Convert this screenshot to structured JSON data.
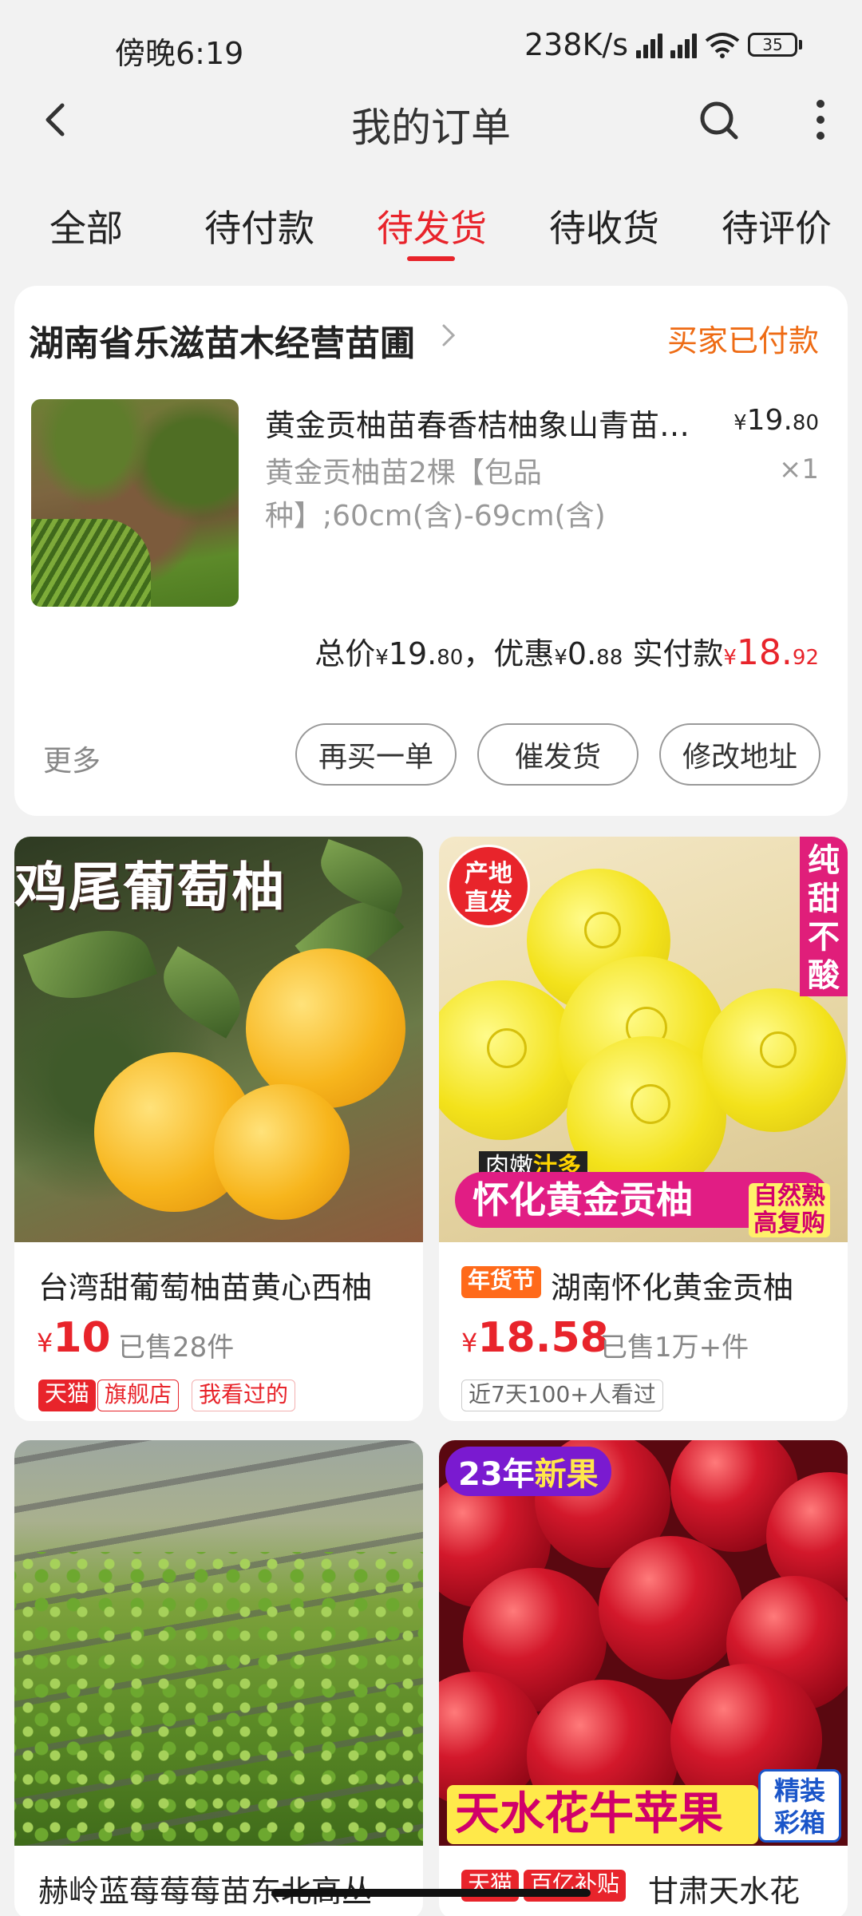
{
  "status_bar": {
    "time": "傍晚6:19",
    "network_speed": "238K/s",
    "battery": "35"
  },
  "nav": {
    "title": "我的订单",
    "icons": [
      "back-icon",
      "search-icon",
      "more-vertical-icon"
    ]
  },
  "tabs": [
    {
      "label": "全部",
      "active": false
    },
    {
      "label": "待付款",
      "active": false
    },
    {
      "label": "待发货",
      "active": true
    },
    {
      "label": "待收货",
      "active": false
    },
    {
      "label": "待评价",
      "active": false
    }
  ],
  "order": {
    "shop_name": "湖南省乐滋苗木经营苗圃",
    "status": "买家已付款",
    "product": {
      "title": "黄金贡柚苗春香桔柚象山青苗…",
      "price_symbol": "¥",
      "price_int": "19.",
      "price_dec": "80",
      "spec": "黄金贡柚苗2棵【包品种】;60cm(含)-69cm(含)",
      "qty": "×1"
    },
    "summary": {
      "total_label": "总价",
      "total_int": "19.",
      "total_dec": "80",
      "comma": "，",
      "discount_label": "优惠",
      "discount_int": "0.",
      "discount_dec": "88",
      "paid_label": "实付款",
      "paid_int": "18.",
      "paid_dec": "92",
      "yen": "¥"
    },
    "more_label": "更多",
    "buttons": [
      "再买一单",
      "催发货",
      "修改地址"
    ]
  },
  "recommendations": [
    {
      "image_text": "鸡尾葡萄柚",
      "title": "台湾甜葡萄柚苗黄心西柚",
      "price_symbol": "¥",
      "price": "10",
      "sold": "已售28件",
      "tags": [
        "天猫",
        "旗舰店",
        "我看过的"
      ]
    },
    {
      "image_badge": [
        "产地",
        "直发"
      ],
      "image_side": [
        "纯",
        "甜",
        "不",
        "酸"
      ],
      "image_small_a": "肉嫩",
      "image_small_b": "汁多",
      "image_strip": "怀化黄金贡柚",
      "image_box": [
        "自然熟",
        "高复购"
      ],
      "promo_tag": "年货节",
      "title": "湖南怀化黄金贡柚",
      "price_symbol": "¥",
      "price": "18.58",
      "sold": "已售1万+件",
      "tags": [
        "近7天100+人看过"
      ]
    },
    {
      "title": "赫岭蓝莓莓莓苗东北高丛"
    },
    {
      "image_badge_a": "23年",
      "image_badge_b": "新果",
      "image_strip": "天水花牛苹果",
      "image_box": [
        "精装",
        "彩箱"
      ],
      "tags": [
        "天猫",
        "百亿补贴"
      ],
      "title": "甘肃天水花"
    }
  ],
  "colors": {
    "accent_red": "#e8242b",
    "status_orange": "#ee6b14",
    "background": "#f2f2f2"
  }
}
